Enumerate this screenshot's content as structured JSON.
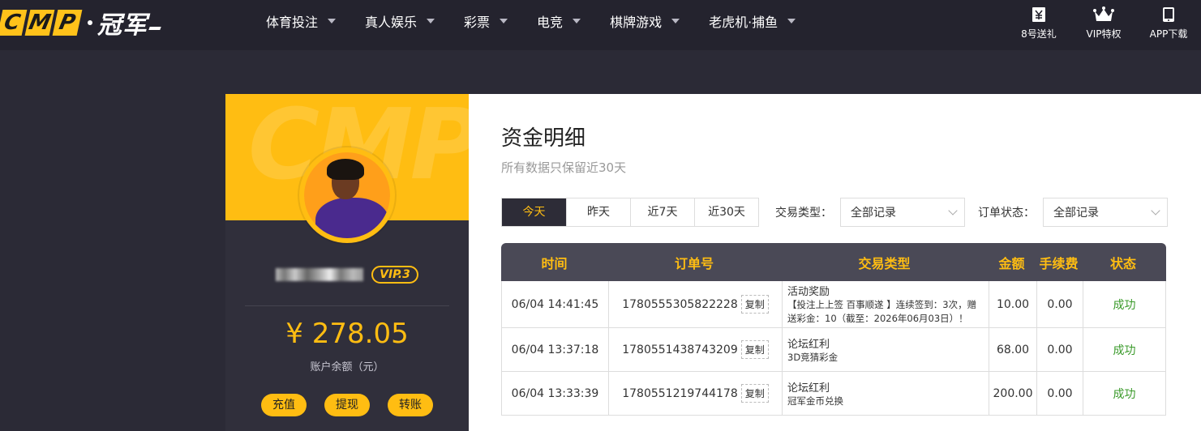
{
  "header": {
    "logo_letters": [
      "C",
      "M",
      "P"
    ],
    "logo_cn": "冠军",
    "nav": [
      {
        "label": "体育投注"
      },
      {
        "label": "真人娱乐"
      },
      {
        "label": "彩票"
      },
      {
        "label": "电竞"
      },
      {
        "label": "棋牌游戏"
      },
      {
        "label": "老虎机·捕鱼"
      }
    ],
    "quick": [
      {
        "label": "8号送礼",
        "icon": "ticket-icon"
      },
      {
        "label": "VIP特权",
        "icon": "crown-icon"
      },
      {
        "label": "APP下载",
        "icon": "tablet-icon"
      }
    ]
  },
  "profile": {
    "banner_watermark": "CMP",
    "vip_label": "VIP.3",
    "balance": "¥ 278.05",
    "balance_label": "账户余额（元）",
    "actions": [
      "充值",
      "提现",
      "转账"
    ]
  },
  "panel": {
    "title": "资金明细",
    "subtitle": "所有数据只保留近30天",
    "tabs": [
      "今天",
      "昨天",
      "近7天",
      "近30天"
    ],
    "active_tab": 0,
    "trade_type_label": "交易类型：",
    "trade_type_value": "全部记录",
    "order_status_label": "订单状态：",
    "order_status_value": "全部记录"
  },
  "table": {
    "columns": [
      "时间",
      "订单号",
      "交易类型",
      "金额",
      "手续费",
      "状态"
    ],
    "copy_label": "复制",
    "rows": [
      {
        "time": "06/04 14:41:45",
        "order": "1780555305822228",
        "type_main": "活动奖励",
        "type_sub": "【投注上上签 百事顺遂 】连续签到：3次，赠送彩金：10（截至：2026年06月03日）！",
        "amount": "10.00",
        "fee": "0.00",
        "status": "成功"
      },
      {
        "time": "06/04 13:37:18",
        "order": "1780551438743209",
        "type_main": "论坛红利",
        "type_sub": "3D竞猜彩金",
        "amount": "68.00",
        "fee": "0.00",
        "status": "成功"
      },
      {
        "time": "06/04 13:33:39",
        "order": "1780551219744178",
        "type_main": "论坛红利",
        "type_sub": "冠军金币兑换",
        "amount": "200.00",
        "fee": "0.00",
        "status": "成功"
      }
    ]
  },
  "colors": {
    "accent": "#ffbd12",
    "header_bg": "#24232e",
    "page_bg": "#2b2a36",
    "success": "#3a9a2a"
  }
}
